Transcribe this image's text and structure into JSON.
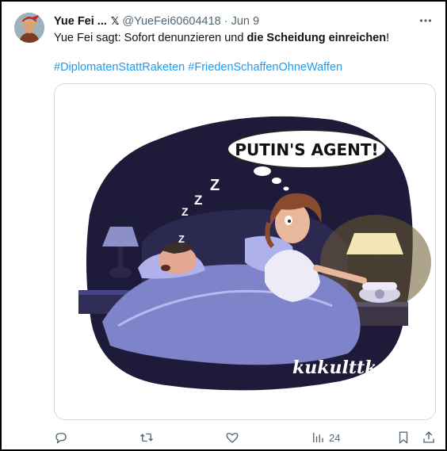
{
  "tweet": {
    "display_name": "Yue Fei ...",
    "badge": "𝕏",
    "handle": "@YueFei60604418",
    "separator": "·",
    "time": "Jun 9",
    "text_before": "Yue Fei sagt: Sofort denunzieren und ",
    "text_bold": "die Scheidung einreichen",
    "text_after": "!",
    "hashtags": [
      "#DiplomatenStattRaketen",
      "#FriedenSchaffenOhneWaffen"
    ]
  },
  "media": {
    "speech_bubble": "PUTIN'S AGENT!",
    "signature": "kukulttka",
    "snore": [
      "Z",
      "Z",
      "Z",
      "Z"
    ]
  },
  "actions": {
    "reply_icon": "reply-icon",
    "retweet_icon": "retweet-icon",
    "like_icon": "heart-icon",
    "views_icon": "views-icon",
    "views_count": "24",
    "bookmark_icon": "bookmark-icon",
    "share_icon": "share-icon"
  },
  "colors": {
    "link": "#1d9bf0",
    "muted": "#536471",
    "text": "#0f1419",
    "night": "#1e1b3a"
  }
}
